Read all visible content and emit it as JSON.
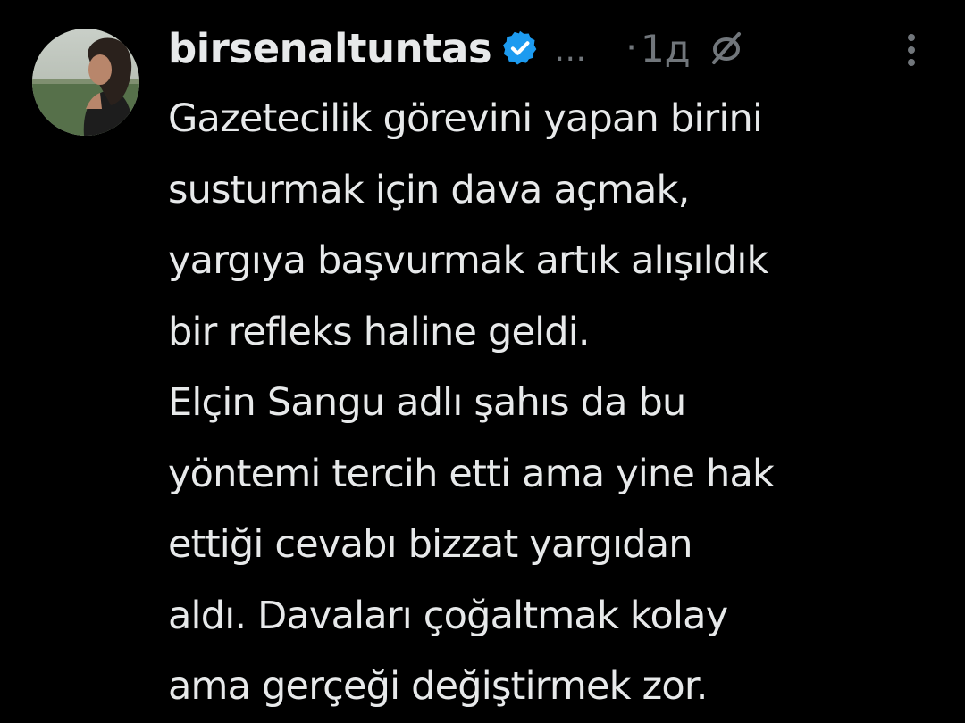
{
  "tweet": {
    "username": "birsenaltuntas",
    "ellipsis": "…",
    "separator": "·",
    "time": "1д",
    "lines": [
      "Gazetecilik görevini yapan birini",
      "susturmak için dava açmak,",
      "yargıya başvurmak artık alışıldık",
      "bir refleks haline geldi.",
      "Elçin Sangu adlı şahıs da bu",
      "yöntemi tercih etti ama yine hak",
      "ettiği cevabı bizzat yargıdan",
      "aldı. Davaları çoğaltmak kolay",
      "ama gerçeği değiştirmek zor."
    ]
  },
  "icons": {
    "verified": "verified-badge-icon",
    "notifications_off": "bell-off-icon",
    "more": "more-vertical-icon"
  },
  "colors": {
    "background": "#000000",
    "text": "#e7e9ea",
    "secondary": "#71767b",
    "verified": "#1d9bf0"
  }
}
